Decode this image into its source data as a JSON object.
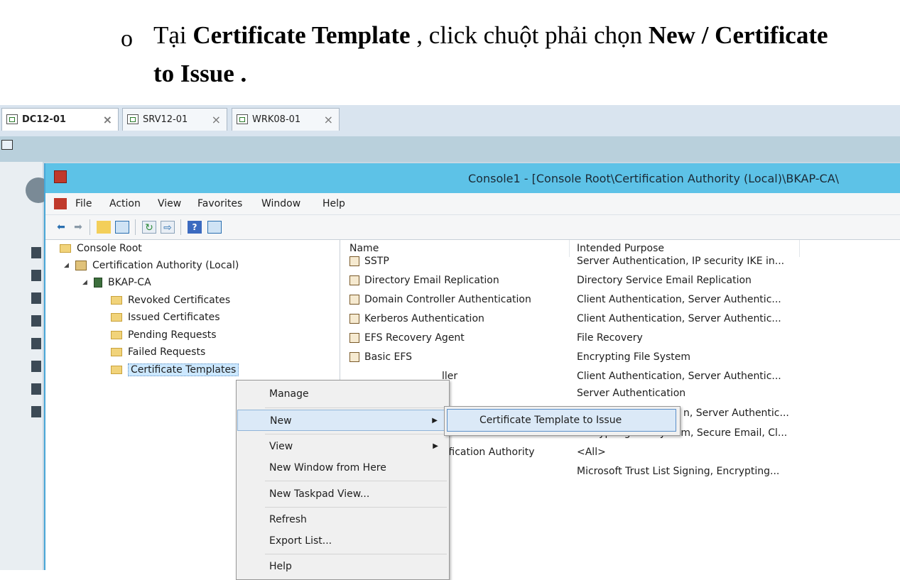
{
  "instruction": {
    "bullet": "o",
    "p1": "Tại ",
    "b1": "Certificate Template",
    "p2": " , click chuột phải chọn ",
    "b2": "New / Certificate",
    "b3": "to Issue .",
    "icon": "circle-bullet-icon"
  },
  "tabs": [
    {
      "label": "DC12-01",
      "close": "×"
    },
    {
      "label": "SRV12-01",
      "close": "×"
    },
    {
      "label": "WRK08-01",
      "close": "×"
    }
  ],
  "window": {
    "title": "Console1 - [Console Root\\Certification Authority (Local)\\BKAP-CA\\",
    "icon": "mmc-console-icon"
  },
  "menubar": [
    "File",
    "Action",
    "View",
    "Favorites",
    "Window",
    "Help"
  ],
  "toolbar": {
    "icons": [
      "back-arrow-icon",
      "forward-arrow-icon",
      "up-folder-icon",
      "show-hide-tree-icon",
      "refresh-icon",
      "export-list-icon",
      "help-icon",
      "show-hide-action-pane-icon"
    ],
    "help_label": "?"
  },
  "tree": {
    "root": "Console Root",
    "ca": "Certification Authority (Local)",
    "server": "BKAP-CA",
    "folders": [
      "Revoked Certificates",
      "Issued Certificates",
      "Pending Requests",
      "Failed Requests",
      "Certificate Templates"
    ],
    "selected": "Certificate Templates"
  },
  "list": {
    "columns": [
      "Name",
      "Intended Purpose"
    ],
    "rows": [
      {
        "name": "SSTP",
        "purpose": "Server Authentication, IP security IKE in..."
      },
      {
        "name": "Directory Email Replication",
        "purpose": "Directory Service Email Replication"
      },
      {
        "name": "Domain Controller Authentication",
        "purpose": "Client Authentication, Server Authentic..."
      },
      {
        "name": "Kerberos Authentication",
        "purpose": "Client Authentication, Server Authentic..."
      },
      {
        "name": "EFS Recovery Agent",
        "purpose": "File Recovery"
      },
      {
        "name": "Basic EFS",
        "purpose": "Encrypting File System"
      },
      {
        "name": "ller",
        "purpose": "Client Authentication, Server Authentic..."
      },
      {
        "name": "",
        "purpose": "Server Authentication"
      },
      {
        "name": "",
        "purpose": "n, Server Authentic..."
      },
      {
        "name": "",
        "purpose": "Encrypting File System, Secure Email, Cl..."
      },
      {
        "name": "tification Authority",
        "purpose": "<All>"
      },
      {
        "name": "",
        "purpose": "Microsoft Trust List Signing, Encrypting..."
      }
    ]
  },
  "context_menu": {
    "items": [
      "Manage",
      "New",
      "View",
      "New Window from Here",
      "New Taskpad View...",
      "Refresh",
      "Export List...",
      "Help"
    ],
    "highlighted": "New",
    "submenu_arrow": "▶"
  },
  "submenu": {
    "item": "Certificate Template to Issue"
  }
}
